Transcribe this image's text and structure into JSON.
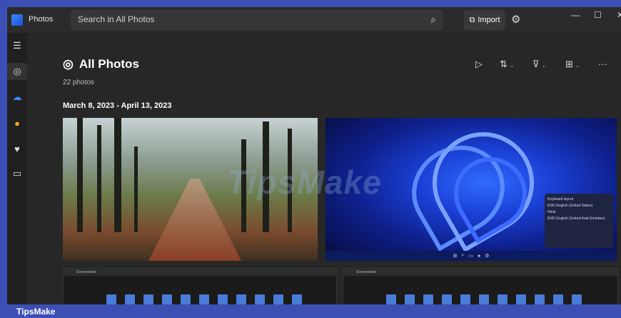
{
  "app": {
    "title": "Photos"
  },
  "search": {
    "placeholder": "Search in All Photos"
  },
  "header": {
    "import_label": "Import"
  },
  "window": {
    "minimize": "—",
    "maximize": "☐",
    "close": "✕"
  },
  "sidebar": {
    "items": [
      {
        "name": "menu-icon",
        "glyph": "☰"
      },
      {
        "name": "all-photos-icon",
        "glyph": "◎"
      },
      {
        "name": "onedrive-icon",
        "glyph": "☁"
      },
      {
        "name": "icloud-icon",
        "glyph": "●"
      },
      {
        "name": "favorites-icon",
        "glyph": "♥"
      },
      {
        "name": "folders-icon",
        "glyph": "🗀"
      }
    ]
  },
  "main": {
    "title": "All Photos",
    "count": "22 photos",
    "date_range": "March 8, 2023 - April 13, 2023"
  },
  "toolbar": {
    "slideshow": "▷",
    "sort": "⇅",
    "filter": "⊽",
    "view": "⊞",
    "more": "···"
  },
  "photos": [
    {
      "name": "forest-path-photo"
    },
    {
      "name": "windows-bloom-photo",
      "panel_title": "Keyboard layout",
      "panel_items": [
        "ENG English (United States)",
        "Hindi",
        "ENG English (United Arab Emirates)"
      ]
    },
    {
      "name": "explorer-screenshot-1",
      "label": "Screenshots"
    },
    {
      "name": "explorer-screenshot-2",
      "label": "Screenshots"
    }
  ],
  "watermark": "TipsMake",
  "footer": {
    "brand": "TipsMake"
  },
  "colors": {
    "accent": "#3b4fb5",
    "background": "#202020",
    "panel": "#272727"
  }
}
